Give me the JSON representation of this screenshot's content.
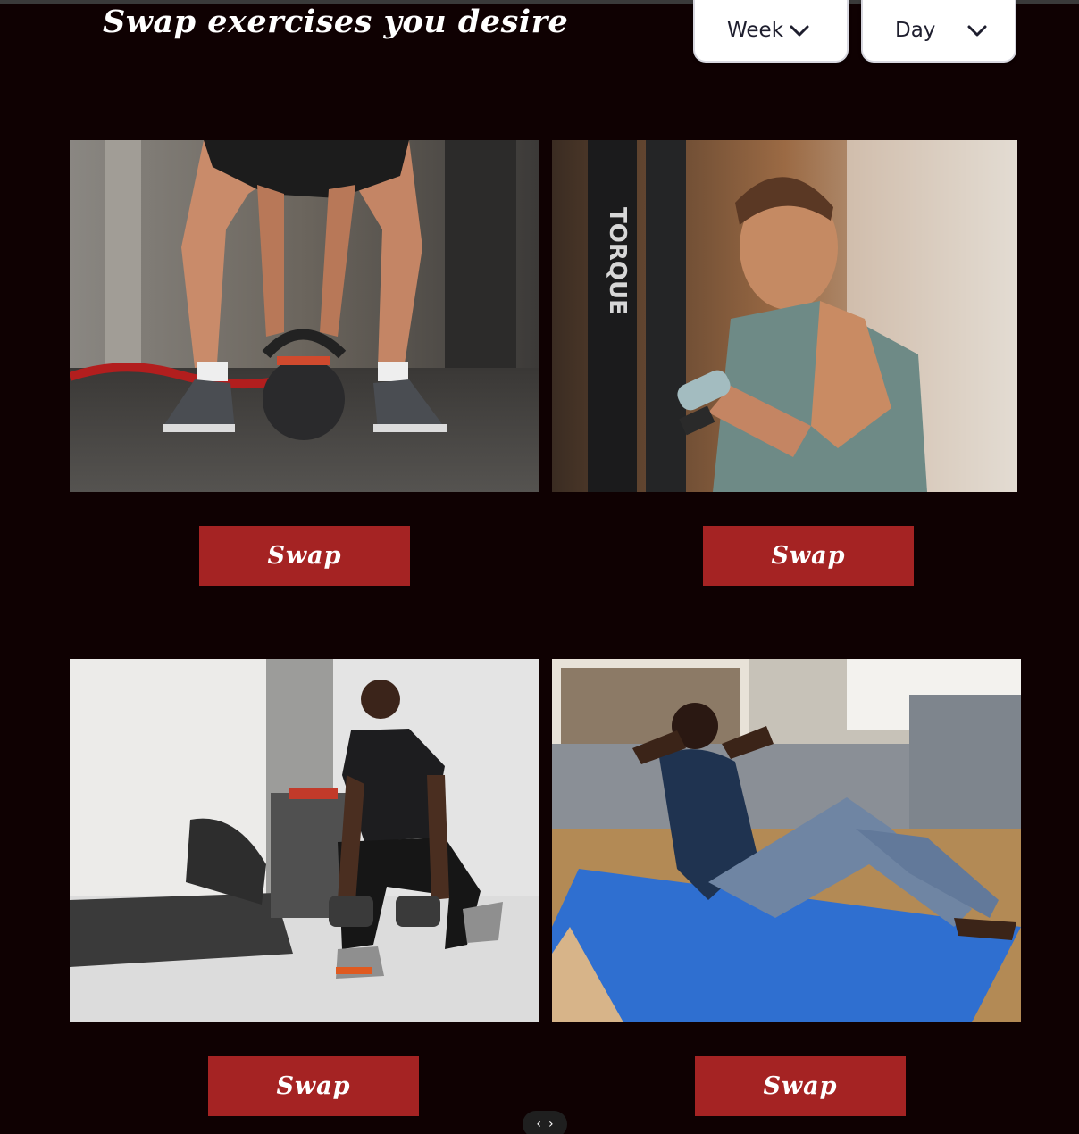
{
  "header": {
    "title": "Swap exercises you desire"
  },
  "filters": {
    "week": {
      "label": "Week",
      "icon": "chevron-down-icon"
    },
    "day": {
      "label": "Day",
      "icon": "chevron-down-icon"
    }
  },
  "exercises": [
    {
      "image": "kettlebell-exercise-photo",
      "button_label": "Swap"
    },
    {
      "image": "bicep-curl-exercise-photo",
      "button_label": "Swap"
    },
    {
      "image": "dumbbell-lunge-exercise-photo",
      "button_label": "Swap"
    },
    {
      "image": "sit-up-exercise-photo",
      "button_label": "Swap"
    }
  ],
  "pager": {
    "prev_icon": "chevron-left-icon",
    "next_icon": "chevron-right-icon",
    "prev_glyph": "‹",
    "next_glyph": "›"
  },
  "colors": {
    "background": "#0f0102",
    "button": "#a52323",
    "dropdown_bg": "#ffffff",
    "dropdown_text": "#1e1e2e"
  }
}
